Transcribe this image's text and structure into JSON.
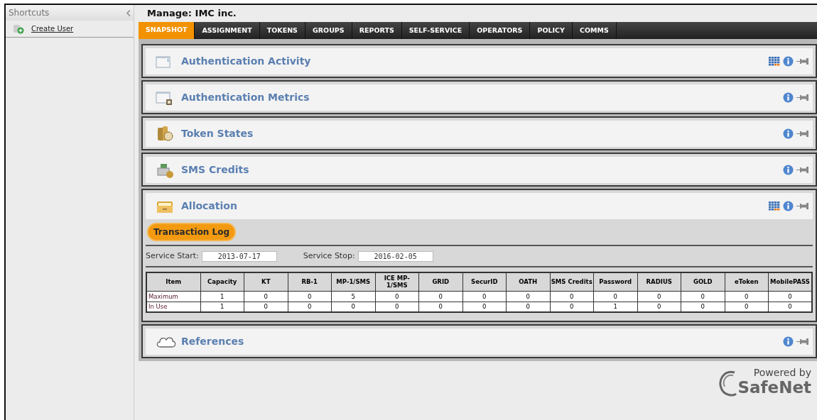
{
  "sidebar": {
    "title": "Shortcuts",
    "items": [
      {
        "label": "Create User"
      }
    ]
  },
  "header": {
    "title": "Manage: IMC inc."
  },
  "tabs": [
    {
      "label": "SNAPSHOT",
      "selected": true
    },
    {
      "label": "ASSIGNMENT",
      "selected": false
    },
    {
      "label": "TOKENS",
      "selected": false
    },
    {
      "label": "GROUPS",
      "selected": false
    },
    {
      "label": "REPORTS",
      "selected": false
    },
    {
      "label": "SELF-SERVICE",
      "selected": false
    },
    {
      "label": "OPERATORS",
      "selected": false
    },
    {
      "label": "POLICY",
      "selected": false
    },
    {
      "label": "COMMS",
      "selected": false
    }
  ],
  "panels": [
    {
      "title": "Authentication Activity",
      "grid_button": true,
      "expanded": false
    },
    {
      "title": "Authentication Metrics",
      "grid_button": false,
      "expanded": false
    },
    {
      "title": "Token States",
      "grid_button": false,
      "expanded": false
    },
    {
      "title": "SMS Credits",
      "grid_button": false,
      "expanded": false
    },
    {
      "title": "Allocation",
      "grid_button": true,
      "expanded": true,
      "button": "Transaction Log",
      "service_start_label": "Service Start:",
      "service_start": "2013-07-17",
      "service_stop_label": "Service Stop:",
      "service_stop": "2016-02-05",
      "table": {
        "columns": [
          "Item",
          "Capacity",
          "KT",
          "RB-1",
          "MP-1/SMS",
          "ICE MP-1/SMS",
          "GRID",
          "SecurID",
          "OATH",
          "SMS Credits",
          "Password",
          "RADIUS",
          "GOLD",
          "eToken",
          "MobilePASS"
        ],
        "rows": [
          [
            "Maximum",
            "1",
            "0",
            "0",
            "5",
            "0",
            "0",
            "0",
            "0",
            "0",
            "0",
            "0",
            "0",
            "0",
            "0"
          ],
          [
            "In Use",
            "1",
            "0",
            "0",
            "0",
            "0",
            "0",
            "0",
            "0",
            "0",
            "1",
            "0",
            "0",
            "0",
            "0"
          ]
        ]
      }
    },
    {
      "title": "References",
      "grid_button": false,
      "expanded": false
    }
  ],
  "footer": {
    "powered_by": "Powered by",
    "brand": "SafeNet"
  }
}
